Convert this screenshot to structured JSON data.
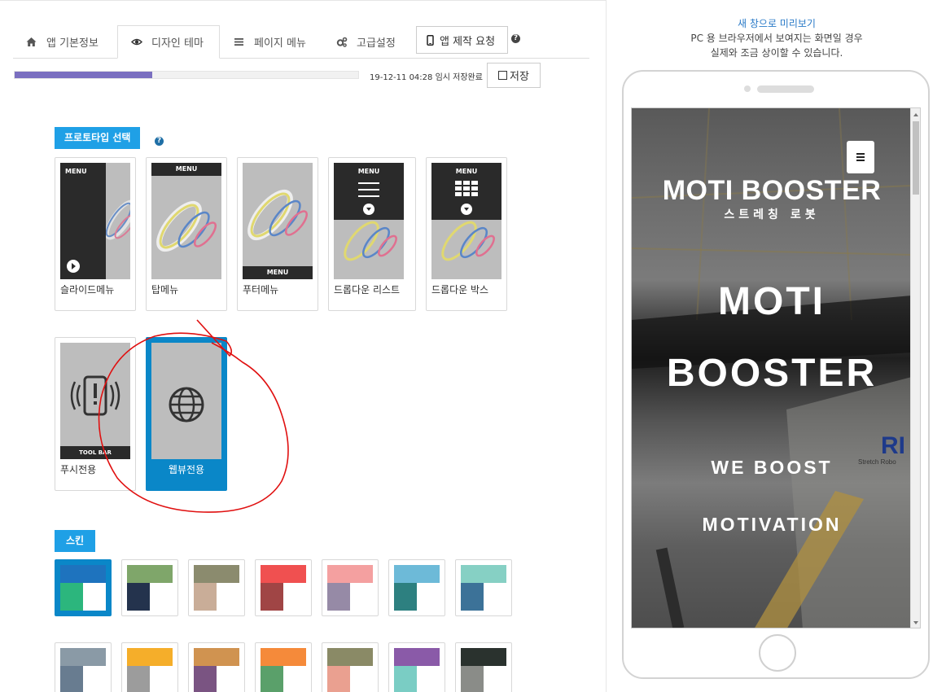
{
  "tabs": [
    {
      "label": "앱 기본정보",
      "icon": "home-icon"
    },
    {
      "label": "디자인 테마",
      "icon": "eye-icon",
      "active": true
    },
    {
      "label": "페이지 메뉴",
      "icon": "list-icon"
    },
    {
      "label": "고급설정",
      "icon": "gears-icon"
    },
    {
      "label": "앱 제작 요청",
      "icon": "mobile-icon"
    }
  ],
  "help_glyph": "?",
  "progress": {
    "percent": 40
  },
  "save_status": "19-12-11 04:28 임시 저장완료",
  "save_label": "저장",
  "prototype": {
    "section_label": "프로토타입 선택",
    "items": [
      {
        "label": "슬라이드메뉴",
        "tag": "MENU"
      },
      {
        "label": "탑메뉴",
        "tag": "MENU"
      },
      {
        "label": "푸터메뉴",
        "tag": "MENU"
      },
      {
        "label": "드롭다운 리스트",
        "tag": "MENU"
      },
      {
        "label": "드롭다운 박스",
        "tag": "MENU"
      },
      {
        "label": "푸시전용",
        "tag": "TOOL BAR"
      },
      {
        "label": "웹뷰전용",
        "selected": true
      }
    ]
  },
  "skin": {
    "section_label": "스킨",
    "swatches": [
      {
        "top": "#1e73be",
        "bottom_left": "#2cb67d",
        "selected": true
      },
      {
        "top": "#7fa66a",
        "bottom_left": "#24334d"
      },
      {
        "top": "#8b8b6e",
        "bottom_left": "#c9ad98"
      },
      {
        "top": "#f05050",
        "bottom_left": "#a04545"
      },
      {
        "top": "#f4a0a0",
        "bottom_left": "#968aa6"
      },
      {
        "top": "#6dbad8",
        "bottom_left": "#2d8080"
      },
      {
        "top": "#86d0c4",
        "bottom_left": "#3c7298"
      },
      {
        "top": "#8a9aa6",
        "bottom_left": "#687c90"
      },
      {
        "top": "#f5ae2a",
        "bottom_left": "#9c9c9c"
      },
      {
        "top": "#d09350",
        "bottom_left": "#7a5482"
      },
      {
        "top": "#f58a3a",
        "bottom_left": "#5aa06a"
      },
      {
        "top": "#8a8a66",
        "bottom_left": "#eaa090"
      },
      {
        "top": "#8a5aa8",
        "bottom_left": "#7acdc4"
      },
      {
        "top": "#2a322e",
        "bottom_left": "#8a8c88"
      }
    ]
  },
  "preview": {
    "link": "새 창으로 미리보기",
    "note_line1": "PC 용 브라우저에서 보여지는 화면일 경우",
    "note_line2": "실제와 조금 상이할 수 있습니다.",
    "brand_title": "MOTI BOOSTER",
    "brand_subtitle": "스트레칭 로봇",
    "headline_1": "MOTI",
    "headline_2": "BOOSTER",
    "tagline_1": "WE BOOST",
    "tagline_2": "MOTIVATION",
    "bg_text": "RI",
    "bg_text_small": "Stretch Robo"
  }
}
